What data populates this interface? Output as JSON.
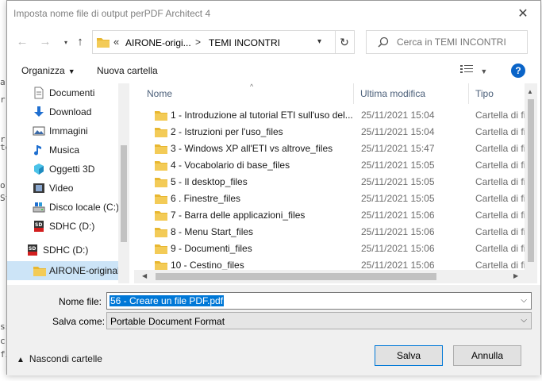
{
  "background_fragments": [
    "ar",
    "r",
    "r",
    "te",
    "o",
    "St",
    "ss",
    "c",
    "fi"
  ],
  "window": {
    "title": "Imposta nome file di output perPDF Architect 4",
    "close_glyph": "✕"
  },
  "nav": {
    "back": "←",
    "forward": "→",
    "up": "↑",
    "refresh": "↻"
  },
  "address": {
    "overflow": "«",
    "segments": [
      "AIRONE-origi...",
      "TEMI INCONTRI"
    ],
    "separator": ">"
  },
  "search": {
    "placeholder": "Cerca in TEMI INCONTRI"
  },
  "toolbar": {
    "organize_label": "Organizza",
    "new_folder_label": "Nuova cartella",
    "help": "?"
  },
  "sidebar": {
    "items": [
      {
        "label": "Documenti",
        "icon": "documents-icon"
      },
      {
        "label": "Download",
        "icon": "download-icon"
      },
      {
        "label": "Immagini",
        "icon": "pictures-icon"
      },
      {
        "label": "Musica",
        "icon": "music-icon"
      },
      {
        "label": "Oggetti 3D",
        "icon": "3d-objects-icon"
      },
      {
        "label": "Video",
        "icon": "video-icon"
      },
      {
        "label": "Disco locale (C:)",
        "icon": "drive-icon"
      },
      {
        "label": "SDHC (D:)",
        "icon": "sd-card-icon"
      },
      {
        "label": "SDHC (D:)",
        "icon": "sd-card-icon"
      },
      {
        "label": "AIRONE-original",
        "icon": "folder-icon",
        "selected": true
      }
    ]
  },
  "columns": {
    "name": "Nome",
    "modified": "Ultima modifica",
    "type": "Tipo"
  },
  "files": [
    {
      "name": "1 - Introduzione al tutorial ETI sull'uso del...",
      "modified": "25/11/2021 15:04",
      "type": "Cartella di file"
    },
    {
      "name": "2 - Istruzioni per l'uso_files",
      "modified": "25/11/2021 15:04",
      "type": "Cartella di file"
    },
    {
      "name": "3 - Windows XP all'ETI vs altrove_files",
      "modified": "25/11/2021 15:47",
      "type": "Cartella di file"
    },
    {
      "name": "4 - Vocabolario di base_files",
      "modified": "25/11/2021 15:05",
      "type": "Cartella di file"
    },
    {
      "name": "5 - Il desktop_files",
      "modified": "25/11/2021 15:05",
      "type": "Cartella di file"
    },
    {
      "name": "6 . Finestre_files",
      "modified": "25/11/2021 15:05",
      "type": "Cartella di file"
    },
    {
      "name": "7 - Barra delle applicazioni_files",
      "modified": "25/11/2021 15:06",
      "type": "Cartella di file"
    },
    {
      "name": "8 - Menu Start_files",
      "modified": "25/11/2021 15:06",
      "type": "Cartella di file"
    },
    {
      "name": "9 - Documenti_files",
      "modified": "25/11/2021 15:06",
      "type": "Cartella di file"
    },
    {
      "name": "10 - Cestino_files",
      "modified": "25/11/2021 15:06",
      "type": "Cartella di file"
    }
  ],
  "form": {
    "filename_label": "Nome file:",
    "filename_value": "56 - Creare un file PDF.pdf",
    "savetype_label": "Salva come:",
    "savetype_value": "Portable Document Format"
  },
  "footer": {
    "hide_folders_label": "Nascondi cartelle",
    "save_label": "Salva",
    "cancel_label": "Annulla"
  },
  "colors": {
    "accent": "#0078d7",
    "folder": "#e8b730",
    "help": "#0a64c8",
    "selection": "#cce4f7"
  }
}
